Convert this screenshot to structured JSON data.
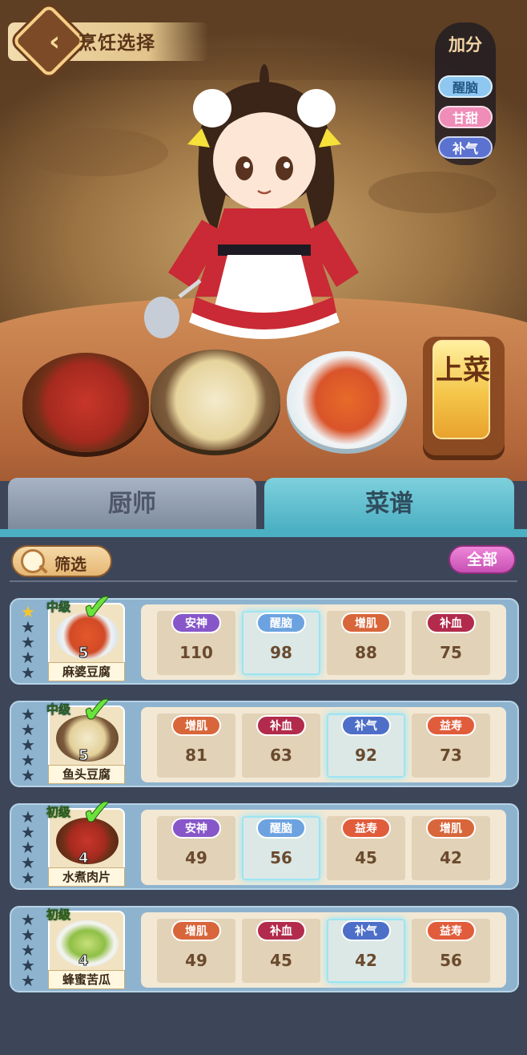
{
  "header": {
    "title": "烹饪选择"
  },
  "bonus": {
    "title": "加分",
    "tags": [
      {
        "label": "醒脑",
        "color": "#8ec8f0",
        "text_color": "#245a86"
      },
      {
        "label": "甘甜",
        "color": "#f08cb8",
        "text_color": "#ffffff"
      },
      {
        "label": "补气",
        "color": "#5b72d0",
        "text_color": "#ffffff"
      }
    ]
  },
  "serve_button": "上菜",
  "tabs": [
    {
      "label": "厨师"
    },
    {
      "label": "菜谱"
    }
  ],
  "filter": {
    "label": "筛选"
  },
  "all_button": "全部",
  "recipes": [
    {
      "name": "麻婆豆腐",
      "tier": "中级",
      "count": "5",
      "checked": true,
      "stars_filled": 1,
      "stats": [
        {
          "tag": "安神",
          "value": "110"
        },
        {
          "tag": "醒脑",
          "value": "98"
        },
        {
          "tag": "增肌",
          "value": "88"
        },
        {
          "tag": "补血",
          "value": "75"
        }
      ]
    },
    {
      "name": "鱼头豆腐",
      "tier": "中级",
      "count": "5",
      "checked": true,
      "stars_filled": 0,
      "stats": [
        {
          "tag": "增肌",
          "value": "81"
        },
        {
          "tag": "补血",
          "value": "63"
        },
        {
          "tag": "补气",
          "value": "92"
        },
        {
          "tag": "益寿",
          "value": "73"
        }
      ]
    },
    {
      "name": "水煮肉片",
      "tier": "初级",
      "count": "4",
      "checked": true,
      "stars_filled": 0,
      "stats": [
        {
          "tag": "安神",
          "value": "49"
        },
        {
          "tag": "醒脑",
          "value": "56"
        },
        {
          "tag": "益寿",
          "value": "45"
        },
        {
          "tag": "增肌",
          "value": "42"
        }
      ]
    },
    {
      "name": "蜂蜜苦瓜",
      "tier": "初级",
      "count": "4",
      "checked": false,
      "stars_filled": 0,
      "stats": [
        {
          "tag": "增肌",
          "value": "49"
        },
        {
          "tag": "补血",
          "value": "45"
        },
        {
          "tag": "补气",
          "value": "42"
        },
        {
          "tag": "益寿",
          "value": "56"
        }
      ]
    }
  ],
  "icons": {
    "back": "back-arrow-icon",
    "filter": "magnifier-icon",
    "check": "checkmark-icon",
    "star": "star-icon"
  }
}
